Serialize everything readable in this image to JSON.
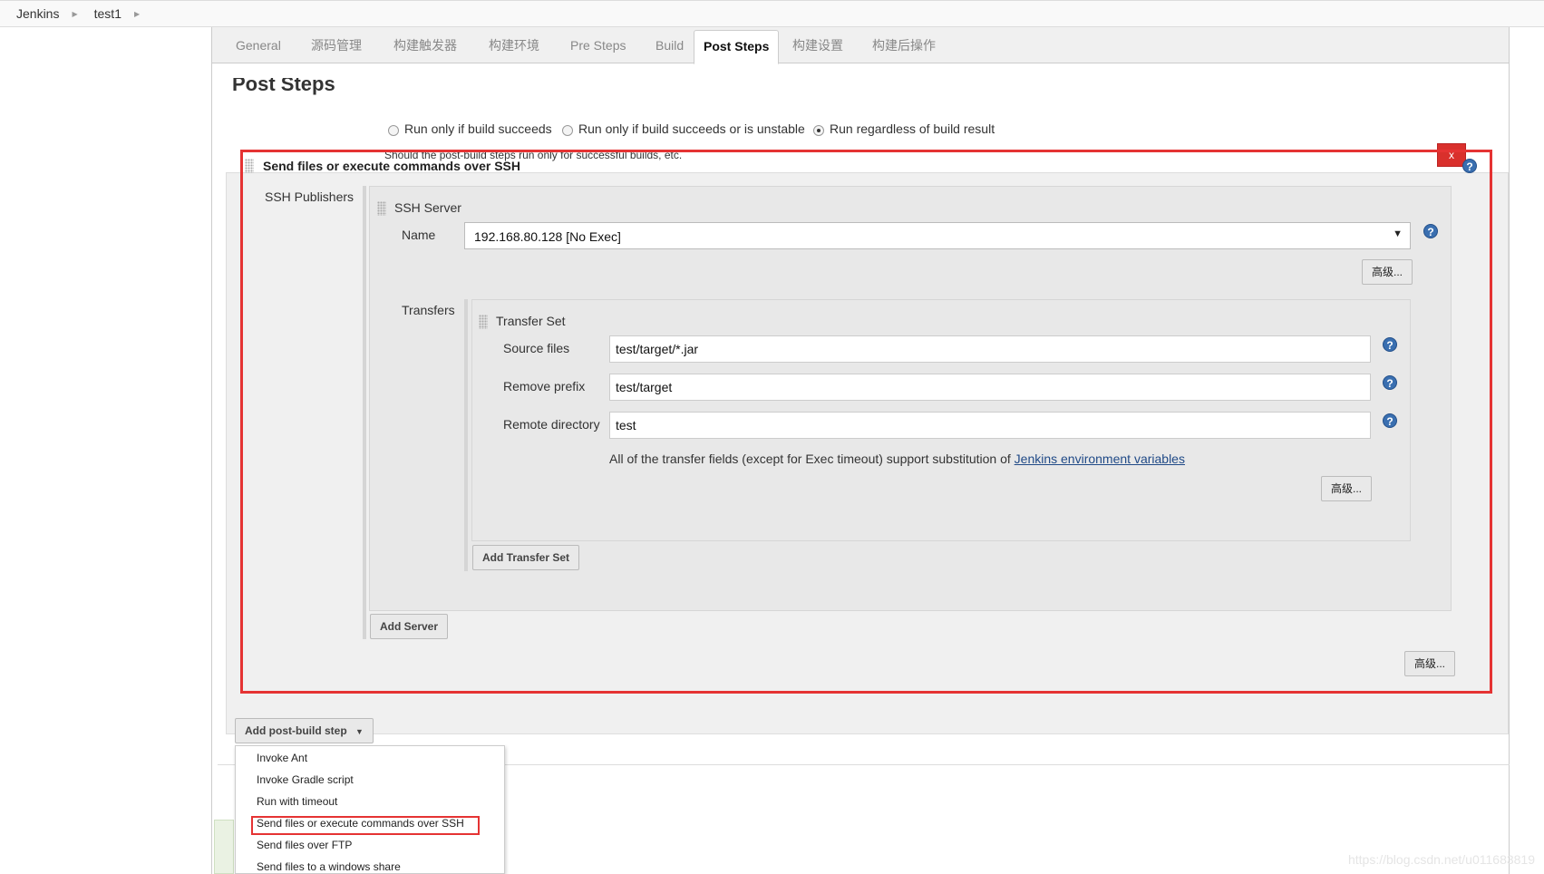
{
  "breadcrumb": [
    "Jenkins",
    "test1"
  ],
  "tabs": [
    {
      "label": "General",
      "active": false
    },
    {
      "label": "源码管理",
      "active": false
    },
    {
      "label": "构建触发器",
      "active": false
    },
    {
      "label": "构建环境",
      "active": false
    },
    {
      "label": "Pre Steps",
      "active": false
    },
    {
      "label": "Build",
      "active": false
    },
    {
      "label": "Post Steps",
      "active": true
    },
    {
      "label": "构建设置",
      "active": false
    },
    {
      "label": "构建后操作",
      "active": false
    }
  ],
  "section_title": "Post Steps",
  "run_options": [
    {
      "label": "Run only if build succeeds",
      "checked": false
    },
    {
      "label": "Run only if build succeeds or is unstable",
      "checked": false
    },
    {
      "label": "Run regardless of build result",
      "checked": true
    }
  ],
  "run_options_help": "Should the post-build steps run only for successful builds, etc.",
  "ssh_step": {
    "title": "Send files or execute commands over SSH",
    "close_label": "x",
    "publishers_label": "SSH Publishers",
    "server_title": "SSH Server",
    "name_label": "Name",
    "name_value": "192.168.80.128 [No Exec]",
    "advanced_label": "高级...",
    "transfers_label": "Transfers",
    "transfer_set_title": "Transfer Set",
    "source_files_label": "Source files",
    "source_files_value": "test/target/*.jar",
    "remove_prefix_label": "Remove prefix",
    "remove_prefix_value": "test/target",
    "remote_dir_label": "Remote directory",
    "remote_dir_value": "test",
    "env_note": "All of the transfer fields (except for Exec timeout) support substitution of",
    "env_link": "Jenkins environment variables",
    "add_transfer_set": "Add Transfer Set",
    "add_server": "Add Server"
  },
  "help_glyph": "?",
  "add_post_build_step": "Add post-build step",
  "dropdown_items": [
    "Invoke Ant",
    "Invoke Gradle script",
    "Run with timeout",
    "Send files or execute commands over SSH",
    "Send files over FTP",
    "Send files to a windows share"
  ],
  "watermark": "https://blog.csdn.net/u011683819",
  "colors": {
    "highlight": "#e53333",
    "help_icon": "#3a6fb0",
    "link": "#204a87"
  },
  "icons": [
    "drag-handle-icon",
    "help-icon",
    "close-icon",
    "caret-down-icon"
  ]
}
